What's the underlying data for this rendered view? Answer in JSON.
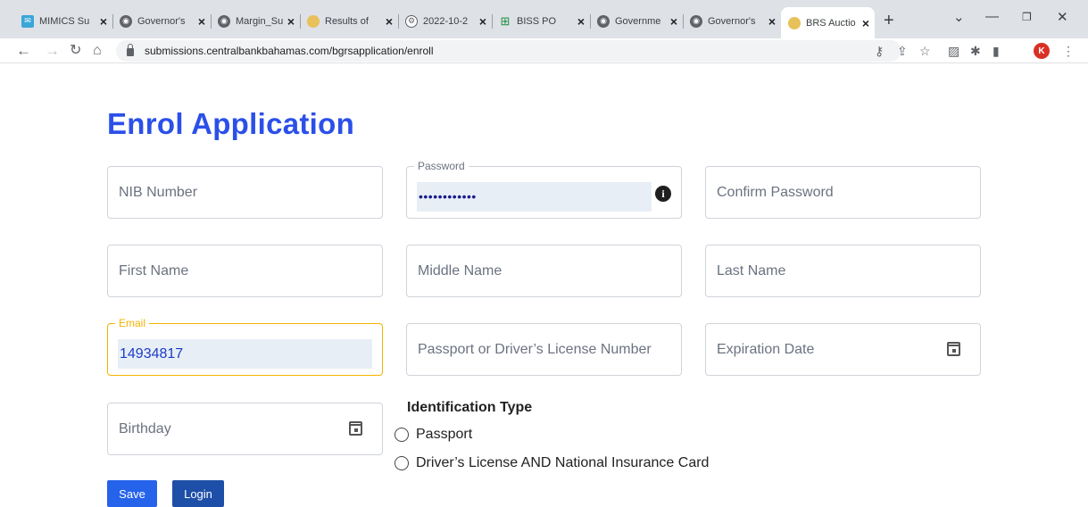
{
  "browser": {
    "tabs": [
      {
        "title": "MIMICS Su",
        "icon": "mail-icon"
      },
      {
        "title": "Governor's",
        "icon": "globe-icon"
      },
      {
        "title": "Margin_Su",
        "icon": "globe-icon"
      },
      {
        "title": "Results of",
        "icon": "seal-icon"
      },
      {
        "title": "2022-10-2",
        "icon": "settings-icon"
      },
      {
        "title": "BISS PO",
        "icon": "chart-icon"
      },
      {
        "title": "Governme",
        "icon": "globe-icon"
      },
      {
        "title": "Governor's",
        "icon": "globe-icon"
      },
      {
        "title": "BRS Auctio",
        "icon": "seal-icon"
      }
    ],
    "url": "submissions.centralbankbahamas.com/bgrsapplication/enroll",
    "profile_initial": "K"
  },
  "page": {
    "title": "Enrol Application",
    "fields": {
      "nib": {
        "placeholder": "NIB Number"
      },
      "password": {
        "label": "Password",
        "value": "••••••••••••"
      },
      "confirm_password": {
        "placeholder": "Confirm Password"
      },
      "first_name": {
        "placeholder": "First Name"
      },
      "middle_name": {
        "placeholder": "Middle Name"
      },
      "last_name": {
        "placeholder": "Last Name"
      },
      "email": {
        "label": "Email",
        "value": "14934817"
      },
      "passport": {
        "placeholder": "Passport or Driver’s License Number"
      },
      "expiration": {
        "placeholder": "Expiration Date"
      },
      "birthday": {
        "placeholder": "Birthday"
      }
    },
    "identification": {
      "heading": "Identification Type",
      "options": [
        "Passport",
        "Driver’s License AND National Insurance Card"
      ]
    },
    "buttons": {
      "save": "Save",
      "login": "Login"
    }
  },
  "colors": {
    "accent": "#2b50e9",
    "focus": "#f4b400",
    "save_button": "#2563eb",
    "login_button": "#1e4fa8"
  }
}
